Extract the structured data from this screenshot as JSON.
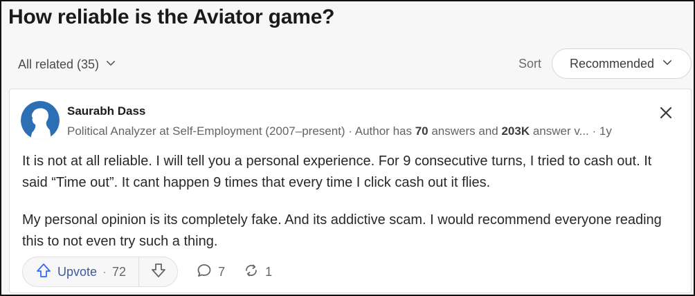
{
  "question": {
    "title": "How reliable is the Aviator game?"
  },
  "filter": {
    "related_label": "All related (35)",
    "sort_label": "Sort",
    "sort_value": "Recommended"
  },
  "answer": {
    "author_name": "Saurabh Dass",
    "credential": "Political Analyzer at Self-Employment (2007–present) · Author has ",
    "answers_count": "70",
    "answers_text": " answers and ",
    "views_count": "203K",
    "views_text": " answer v...",
    "age": " · 1y",
    "paragraphs": [
      "It is not at all reliable. I will tell you a personal experience. For 9 consecutive turns, I tried to cash out. It said “Time out”. It cant happen 9 times that every time I click cash out it flies.",
      "My personal opinion is its completely fake. And its addictive scam. I would recommend everyone reading this to not even try such a thing."
    ],
    "upvote_label": "Upvote",
    "upvote_count": "72",
    "comment_count": "7",
    "share_count": "1"
  },
  "colors": {
    "accent_blue": "#2e69ff",
    "avatar_bg": "#2c6fb5",
    "text_dark": "#282829"
  },
  "icons": [
    "chevron-down-icon",
    "close-icon",
    "upvote-arrow-icon",
    "downvote-arrow-icon",
    "comment-icon",
    "share-icon",
    "avatar-silhouette"
  ]
}
